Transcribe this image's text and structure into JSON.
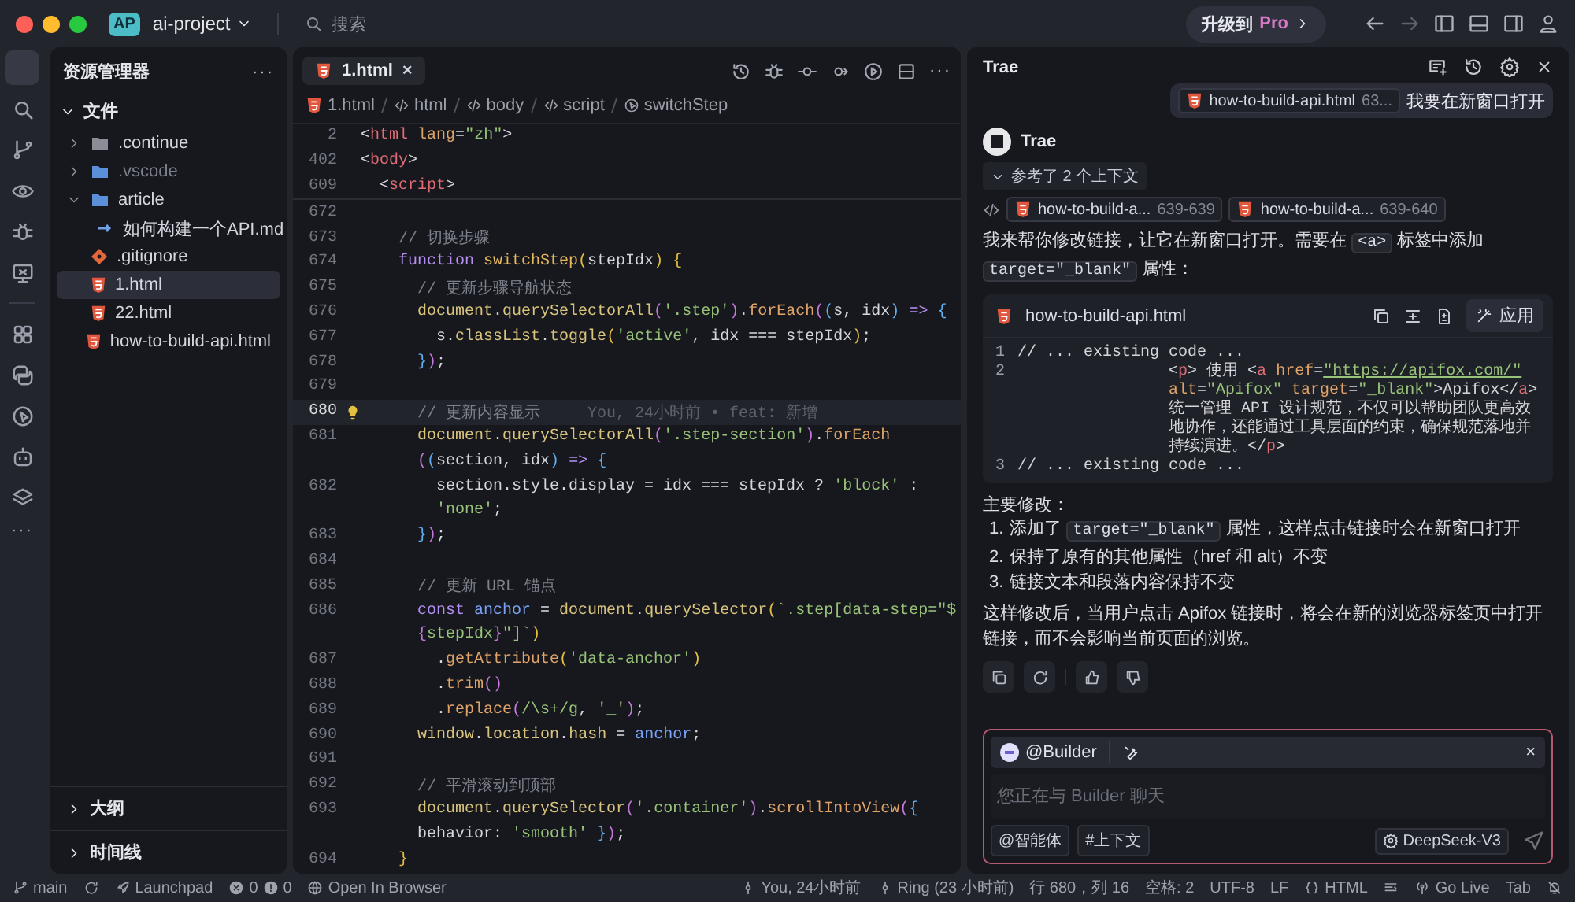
{
  "title_bar": {
    "app_badge": "AP",
    "project": "ai-project",
    "search_placeholder": "搜索",
    "upgrade": {
      "text": "升级到",
      "pro": "Pro"
    }
  },
  "activity_bar": {
    "items": [
      {
        "kind": "files",
        "selected": true
      },
      {
        "kind": "search",
        "selected": false
      },
      {
        "kind": "branch",
        "selected": false
      },
      {
        "kind": "eye",
        "selected": false
      },
      {
        "kind": "bug",
        "selected": false
      },
      {
        "kind": "monitor",
        "selected": false
      },
      {
        "kind": "grid",
        "selected": false
      },
      {
        "kind": "plugin",
        "selected": false
      },
      {
        "kind": "cursor",
        "selected": false
      },
      {
        "kind": "robot",
        "selected": false
      },
      {
        "kind": "layers",
        "selected": false
      }
    ],
    "more": "···"
  },
  "explorer": {
    "title": "资源管理器",
    "more": "···",
    "section": {
      "label": "文件",
      "expanded": true
    },
    "tree": [
      {
        "name": ".continue",
        "kind": "folder",
        "expanded": false,
        "dimmed": false,
        "selected": false
      },
      {
        "name": ".vscode",
        "kind": "folder-blue",
        "expanded": false,
        "dimmed": true,
        "selected": false
      },
      {
        "name": "article",
        "kind": "folder-blue",
        "expanded": true,
        "dimmed": false,
        "selected": false,
        "children": [
          {
            "name": "如何构建一个API.md",
            "kind": "md",
            "dimmed": false,
            "selected": false
          }
        ]
      },
      {
        "name": ".gitignore",
        "kind": "git",
        "dimmed": false,
        "selected": false
      },
      {
        "name": "1.html",
        "kind": "html",
        "dimmed": false,
        "selected": true
      },
      {
        "name": "22.html",
        "kind": "html",
        "dimmed": false,
        "selected": false
      },
      {
        "name": "how-to-build-api.html",
        "kind": "html",
        "dimmed": false,
        "selected": false
      }
    ],
    "panels": [
      {
        "label": "大纲",
        "expanded": false
      },
      {
        "label": "时间线",
        "expanded": false
      }
    ]
  },
  "editor": {
    "tab": {
      "label": "1.html",
      "close": "×"
    },
    "more": "···",
    "breadcrumbs": [
      {
        "label": "1.html",
        "kind": "file"
      },
      {
        "label": "html",
        "kind": "element"
      },
      {
        "label": "body",
        "kind": "element"
      },
      {
        "label": "script",
        "kind": "element"
      },
      {
        "label": "switchStep",
        "kind": "function"
      }
    ],
    "sticky": [
      {
        "number": "2",
        "tokens": [
          {
            "kind": "plain",
            "text": "<"
          },
          {
            "kind": "tag",
            "text": "html"
          },
          {
            "kind": "method",
            "text": " lang"
          },
          {
            "kind": "plain",
            "text": "="
          },
          {
            "kind": "string",
            "text": "\"zh\""
          },
          {
            "kind": "plain",
            "text": ">"
          }
        ]
      },
      {
        "number": "402",
        "tokens": [
          {
            "kind": "plain",
            "text": "<"
          },
          {
            "kind": "tag",
            "text": "body"
          },
          {
            "kind": "plain",
            "text": ">"
          }
        ]
      },
      {
        "number": "609",
        "tokens": [
          {
            "kind": "plain",
            "text": "  <"
          },
          {
            "kind": "tag",
            "text": "script"
          },
          {
            "kind": "plain",
            "text": ">"
          }
        ]
      }
    ],
    "lines": [
      {
        "number": "672",
        "current": false
      },
      {
        "number": "673",
        "current": false,
        "tokens": [
          {
            "kind": "comment",
            "text": "    // 切换步骤"
          }
        ]
      },
      {
        "number": "674",
        "current": false,
        "tokens": [
          {
            "kind": "keyword",
            "text": "    function"
          },
          {
            "kind": "function",
            "text": " switchStep"
          },
          {
            "kind": "bracket1",
            "text": "("
          },
          {
            "kind": "plain",
            "text": "stepIdx"
          },
          {
            "kind": "bracket1",
            "text": ")"
          },
          {
            "kind": "bracket1",
            "text": " {"
          }
        ]
      },
      {
        "number": "675",
        "current": false,
        "tokens": [
          {
            "kind": "comment",
            "text": "      // 更新步骤导航状态"
          }
        ]
      },
      {
        "number": "676",
        "current": false,
        "tokens": [
          {
            "kind": "identifier",
            "text": "      document"
          },
          {
            "kind": "plain",
            "text": "."
          },
          {
            "kind": "identifier",
            "text": "querySelectorAll"
          },
          {
            "kind": "bracket2",
            "text": "("
          },
          {
            "kind": "string",
            "text": "'.step'"
          },
          {
            "kind": "bracket2",
            "text": ")"
          },
          {
            "kind": "plain",
            "text": "."
          },
          {
            "kind": "method",
            "text": "forEach"
          },
          {
            "kind": "bracket2",
            "text": "("
          },
          {
            "kind": "bracket3",
            "text": "("
          },
          {
            "kind": "plain",
            "text": "s, idx"
          },
          {
            "kind": "bracket3",
            "text": ")"
          },
          {
            "kind": "keyword",
            "text": " =>"
          },
          {
            "kind": "bracket3",
            "text": " {"
          }
        ]
      },
      {
        "number": "677",
        "current": false,
        "tokens": [
          {
            "kind": "plain",
            "text": "        s."
          },
          {
            "kind": "identifier",
            "text": "classList"
          },
          {
            "kind": "plain",
            "text": "."
          },
          {
            "kind": "identifier",
            "text": "toggle"
          },
          {
            "kind": "bracket1",
            "text": "("
          },
          {
            "kind": "string",
            "text": "'active'"
          },
          {
            "kind": "plain",
            "text": ", idx === stepIdx"
          },
          {
            "kind": "bracket1",
            "text": ")"
          },
          {
            "kind": "plain",
            "text": ";"
          }
        ]
      },
      {
        "number": "678",
        "current": false,
        "tokens": [
          {
            "kind": "bracket3",
            "text": "      }"
          },
          {
            "kind": "bracket2",
            "text": ")"
          },
          {
            "kind": "plain",
            "text": ";"
          }
        ]
      },
      {
        "number": "679",
        "current": false
      },
      {
        "number": "680",
        "current": true,
        "blame": "You, 24小时前 • feat: 新增",
        "tokens": [
          {
            "kind": "comment",
            "text": "      // 更新内容显示"
          }
        ]
      },
      {
        "number": "681",
        "current": false,
        "tokens": [
          {
            "kind": "identifier",
            "text": "      document"
          },
          {
            "kind": "plain",
            "text": "."
          },
          {
            "kind": "identifier",
            "text": "querySelectorAll"
          },
          {
            "kind": "bracket2",
            "text": "("
          },
          {
            "kind": "string",
            "text": "'.step-section'"
          },
          {
            "kind": "bracket2",
            "text": ")"
          },
          {
            "kind": "plain",
            "text": "."
          },
          {
            "kind": "method",
            "text": "forEach"
          }
        ]
      },
      {
        "current": false,
        "tokens": [
          {
            "kind": "bracket2",
            "text": "      ("
          },
          {
            "kind": "bracket3",
            "text": "("
          },
          {
            "kind": "plain",
            "text": "section, idx"
          },
          {
            "kind": "bracket3",
            "text": ")"
          },
          {
            "kind": "keyword",
            "text": " =>"
          },
          {
            "kind": "bracket3",
            "text": " {"
          }
        ]
      },
      {
        "number": "682",
        "current": false,
        "tokens": [
          {
            "kind": "plain",
            "text": "        section.style.display = idx === stepIdx ? "
          },
          {
            "kind": "string",
            "text": "'block'"
          },
          {
            "kind": "plain",
            "text": " :"
          }
        ]
      },
      {
        "current": false,
        "tokens": [
          {
            "kind": "string",
            "text": "        'none'"
          },
          {
            "kind": "plain",
            "text": ";"
          }
        ]
      },
      {
        "number": "683",
        "current": false,
        "tokens": [
          {
            "kind": "bracket3",
            "text": "      }"
          },
          {
            "kind": "bracket2",
            "text": ")"
          },
          {
            "kind": "plain",
            "text": ";"
          }
        ]
      },
      {
        "number": "684",
        "current": false
      },
      {
        "number": "685",
        "current": false,
        "tokens": [
          {
            "kind": "comment",
            "text": "      // 更新 URL 锚点"
          }
        ]
      },
      {
        "number": "686",
        "current": false,
        "tokens": [
          {
            "kind": "keyword",
            "text": "      const"
          },
          {
            "kind": "variable",
            "text": " anchor"
          },
          {
            "kind": "plain",
            "text": " = "
          },
          {
            "kind": "identifier",
            "text": "document"
          },
          {
            "kind": "plain",
            "text": "."
          },
          {
            "kind": "identifier",
            "text": "querySelector"
          },
          {
            "kind": "bracket1",
            "text": "("
          },
          {
            "kind": "string",
            "text": "`.step[data-step=\"$"
          }
        ]
      },
      {
        "current": false,
        "tokens": [
          {
            "kind": "bracket2",
            "text": "      {"
          },
          {
            "kind": "string",
            "text": "stepIdx"
          },
          {
            "kind": "bracket2",
            "text": "}"
          },
          {
            "kind": "string",
            "text": "\"]`"
          },
          {
            "kind": "bracket1",
            "text": ")"
          }
        ]
      },
      {
        "number": "687",
        "current": false,
        "tokens": [
          {
            "kind": "plain",
            "text": "        ."
          },
          {
            "kind": "method",
            "text": "getAttribute"
          },
          {
            "kind": "bracket1",
            "text": "("
          },
          {
            "kind": "string",
            "text": "'data-anchor'"
          },
          {
            "kind": "bracket1",
            "text": ")"
          }
        ]
      },
      {
        "number": "688",
        "current": false,
        "tokens": [
          {
            "kind": "plain",
            "text": "        ."
          },
          {
            "kind": "method",
            "text": "trim"
          },
          {
            "kind": "bracket2",
            "text": "()"
          }
        ]
      },
      {
        "number": "689",
        "current": false,
        "tokens": [
          {
            "kind": "plain",
            "text": "        ."
          },
          {
            "kind": "method",
            "text": "replace"
          },
          {
            "kind": "bracket2",
            "text": "("
          },
          {
            "kind": "string",
            "text": "/\\s+/g"
          },
          {
            "kind": "plain",
            "text": ","
          },
          {
            "kind": "string",
            "text": " '_'"
          },
          {
            "kind": "bracket2",
            "text": ")"
          },
          {
            "kind": "plain",
            "text": ";"
          }
        ]
      },
      {
        "number": "690",
        "current": false,
        "tokens": [
          {
            "kind": "identifier",
            "text": "      window"
          },
          {
            "kind": "plain",
            "text": "."
          },
          {
            "kind": "identifier",
            "text": "location"
          },
          {
            "kind": "plain",
            "text": "."
          },
          {
            "kind": "identifier",
            "text": "hash"
          },
          {
            "kind": "plain",
            "text": " ="
          },
          {
            "kind": "variable",
            "text": " anchor"
          },
          {
            "kind": "plain",
            "text": ";"
          }
        ]
      },
      {
        "number": "691",
        "current": false
      },
      {
        "number": "692",
        "current": false,
        "tokens": [
          {
            "kind": "comment",
            "text": "      // 平滑滚动到顶部"
          }
        ]
      },
      {
        "number": "693",
        "current": false,
        "tokens": [
          {
            "kind": "identifier",
            "text": "      document"
          },
          {
            "kind": "plain",
            "text": "."
          },
          {
            "kind": "identifier",
            "text": "querySelector"
          },
          {
            "kind": "bracket2",
            "text": "("
          },
          {
            "kind": "string",
            "text": "'.container'"
          },
          {
            "kind": "bracket2",
            "text": ")"
          },
          {
            "kind": "plain",
            "text": "."
          },
          {
            "kind": "method",
            "text": "scrollIntoView"
          },
          {
            "kind": "bracket2",
            "text": "("
          },
          {
            "kind": "bracket3",
            "text": "{"
          }
        ]
      },
      {
        "current": false,
        "tokens": [
          {
            "kind": "plain",
            "text": "      behavior:"
          },
          {
            "kind": "string",
            "text": " 'smooth'"
          },
          {
            "kind": "bracket3",
            "text": " }"
          },
          {
            "kind": "bracket2",
            "text": ")"
          },
          {
            "kind": "plain",
            "text": ";"
          }
        ]
      },
      {
        "number": "694",
        "current": false,
        "tokens": [
          {
            "kind": "bracket1",
            "text": "    }"
          }
        ]
      }
    ]
  },
  "chat": {
    "title": "Trae",
    "user_message": {
      "file": "how-to-build-api.html",
      "range": "63...",
      "text": "我要在新窗口打开"
    },
    "assistant": {
      "name": "Trae",
      "references": {
        "label": "参考了 2 个上下文",
        "expanded": true
      },
      "context_chips": [
        {
          "file": "how-to-build-a...",
          "range": "639-639"
        },
        {
          "file": "how-to-build-a...",
          "range": "639-640"
        }
      ],
      "intro": [
        {
          "kind": "text",
          "text": "我来帮你修改链接，让它在新窗口打开。需要在 "
        },
        {
          "kind": "code",
          "text": "<a>"
        },
        {
          "kind": "text",
          "text": " 标签中添加 "
        },
        {
          "kind": "code",
          "text": "target=\"_blank\""
        },
        {
          "kind": "text",
          "text": " 属性："
        }
      ],
      "code_block": {
        "file": "how-to-build-api.html",
        "apply": "应用",
        "lines": [
          {
            "number": "1",
            "indent": false,
            "tokens": [
              {
                "kind": "plain",
                "text": "// ... existing code ..."
              }
            ]
          },
          {
            "number": "2",
            "indent": true,
            "tokens": [
              {
                "kind": "plain",
                "text": "<"
              },
              {
                "kind": "tag",
                "text": "p"
              },
              {
                "kind": "plain",
                "text": "> 使用 <"
              },
              {
                "kind": "tag",
                "text": "a"
              },
              {
                "kind": "method",
                "text": " href"
              },
              {
                "kind": "plain",
                "text": "="
              },
              {
                "kind": "link",
                "text": "\"https://apifox.com/\""
              },
              {
                "kind": "method",
                "text": " alt"
              },
              {
                "kind": "plain",
                "text": "="
              },
              {
                "kind": "string",
                "text": "\"Apifox\""
              },
              {
                "kind": "method",
                "text": " target"
              },
              {
                "kind": "plain",
                "text": "="
              },
              {
                "kind": "string",
                "text": "\"_blank\""
              },
              {
                "kind": "plain",
                "text": ">Apifox</"
              },
              {
                "kind": "tag",
                "text": "a"
              },
              {
                "kind": "plain",
                "text": "> 统一管理 API 设计规范，不仅可以帮助团队更高效地协作，还能通过工具层面的约束，确保规范落地并持续演进。</"
              },
              {
                "kind": "tag",
                "text": "p"
              },
              {
                "kind": "plain",
                "text": ">"
              }
            ]
          },
          {
            "number": "3",
            "indent": false,
            "tokens": [
              {
                "kind": "plain",
                "text": "// ... existing code ..."
              }
            ]
          }
        ]
      },
      "summary_title": "主要修改：",
      "changes": [
        {
          "marker": "1.",
          "segments": [
            {
              "kind": "text",
              "text": "添加了 "
            },
            {
              "kind": "code",
              "text": "target=\"_blank\""
            },
            {
              "kind": "text",
              "text": " 属性，这样点击链接时会在新窗口打开"
            }
          ]
        },
        {
          "marker": "2.",
          "segments": [
            {
              "kind": "text",
              "text": "保持了原有的其他属性（href 和 alt）不变"
            }
          ]
        },
        {
          "marker": "3.",
          "segments": [
            {
              "kind": "text",
              "text": "链接文本和段落内容保持不变"
            }
          ]
        }
      ],
      "conclusion": "这样修改后，当用户点击 Apifox 链接时，将会在新的浏览器标签页中打开链接，而不会影响当前页面的浏览。"
    },
    "input": {
      "agent": "@Builder",
      "close": "×",
      "placeholder": "您正在与 Builder 聊天",
      "agent_button": "@智能体",
      "context_button": "#上下文",
      "model": "DeepSeek-V3"
    }
  },
  "status_bar": {
    "branch": "main",
    "launchpad": "Launchpad",
    "errors": "0",
    "warnings": "0",
    "open_in_browser": "Open In Browser",
    "blame": "You, 24小时前",
    "ring": "Ring (23 小时前)",
    "position": "行 680，列 16",
    "spaces": "空格: 2",
    "encoding": "UTF-8",
    "eol": "LF",
    "language": "HTML",
    "go_live": "Go Live",
    "tab": "Tab"
  }
}
